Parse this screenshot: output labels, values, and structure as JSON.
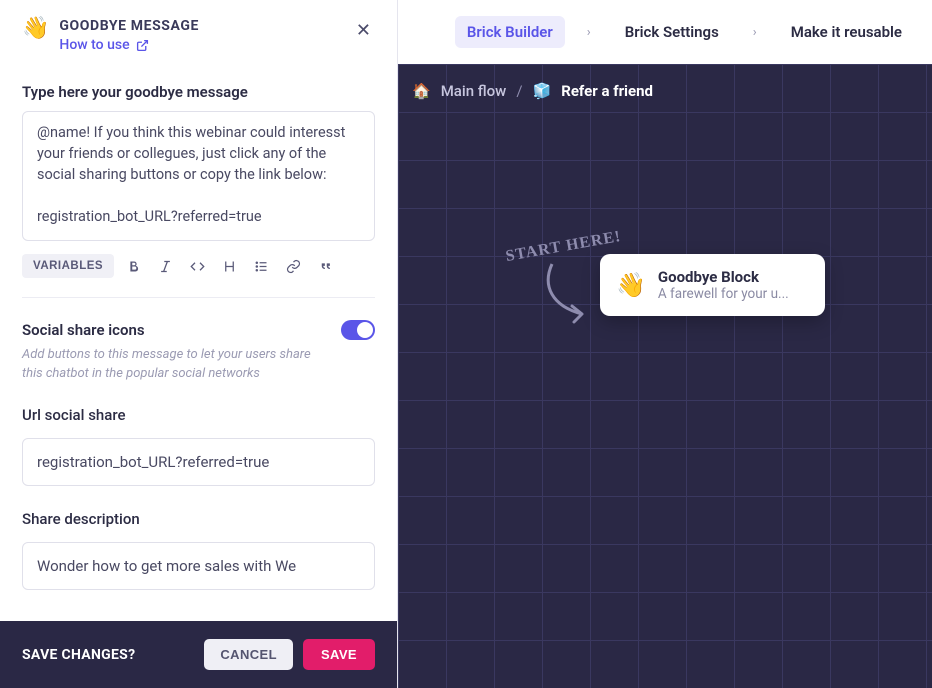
{
  "panel": {
    "emoji": "👋",
    "title": "GOODBYE MESSAGE",
    "how_to_use": "How to use",
    "message_label": "Type here your goodbye message",
    "message_value": "@name! If you think this webinar could interesst your friends or collegues, just click any of the social sharing buttons or copy the link below:\n\nregistration_bot_URL?referred=true",
    "variables_btn": "VARIABLES",
    "social_icons": {
      "title": "Social share icons",
      "helper": "Add buttons to this message to let your users share this chatbot in the popular social networks",
      "enabled": true
    },
    "url_label": "Url social share",
    "url_value": "registration_bot_URL?referred=true",
    "share_desc_label": "Share description",
    "share_desc_value": "Wonder how to get more sales with We"
  },
  "footer": {
    "label": "SAVE CHANGES?",
    "cancel": "CANCEL",
    "save": "SAVE"
  },
  "topbar": {
    "items": [
      "Brick Builder",
      "Brick Settings",
      "Make it reusable"
    ],
    "sep": "›"
  },
  "canvas": {
    "breadcrumb": {
      "home_emoji": "🏠",
      "home_label": "Main flow",
      "slash": "/",
      "brick_emoji": "🧊",
      "brick_label": "Refer a friend"
    },
    "start_here": "START HERE!",
    "node": {
      "emoji": "👋",
      "title": "Goodbye Block",
      "subtitle": "A farewell for your u..."
    }
  }
}
